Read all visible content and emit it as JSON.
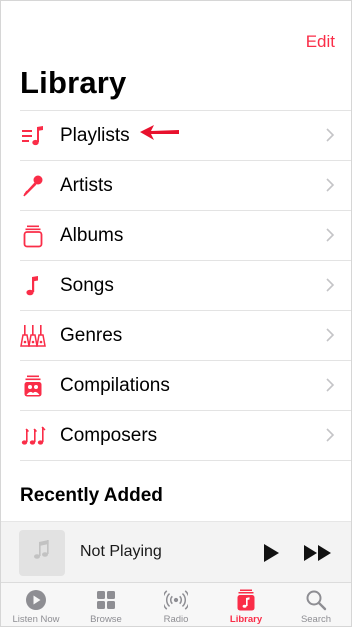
{
  "header": {
    "edit_label": "Edit",
    "title": "Library"
  },
  "library_items": [
    {
      "label": "Playlists",
      "icon": "playlists-icon"
    },
    {
      "label": "Artists",
      "icon": "artists-icon"
    },
    {
      "label": "Albums",
      "icon": "albums-icon"
    },
    {
      "label": "Songs",
      "icon": "songs-icon"
    },
    {
      "label": "Genres",
      "icon": "genres-icon"
    },
    {
      "label": "Compilations",
      "icon": "compilations-icon"
    },
    {
      "label": "Composers",
      "icon": "composers-icon"
    }
  ],
  "recently_added": {
    "title": "Recently Added"
  },
  "mini_player": {
    "title": "Not Playing"
  },
  "tabs": [
    {
      "label": "Listen Now",
      "icon": "listen-now-icon",
      "active": false
    },
    {
      "label": "Browse",
      "icon": "browse-icon",
      "active": false
    },
    {
      "label": "Radio",
      "icon": "radio-icon",
      "active": false
    },
    {
      "label": "Library",
      "icon": "library-icon",
      "active": true
    },
    {
      "label": "Search",
      "icon": "search-icon",
      "active": false
    }
  ],
  "colors": {
    "accent": "#fa2d48",
    "annotation_arrow": "#e8112d",
    "inactive": "#8e8e93"
  }
}
